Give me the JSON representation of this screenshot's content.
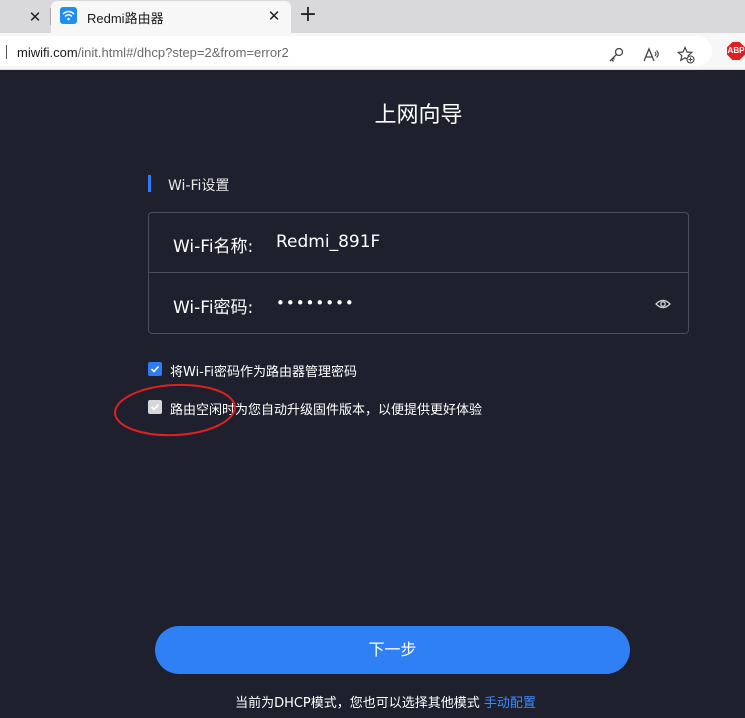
{
  "browser": {
    "tab_title": "Redmi路由器",
    "close_glyph": "✕",
    "new_tab_glyph": "+",
    "url_host": "miwifi.com",
    "url_path": "/init.html#/dhcp?step=2&from=error2",
    "icons": [
      "wifi-favicon-icon",
      "key-icon",
      "read-aloud-icon",
      "favorite-icon",
      "adblock-icon"
    ],
    "abp_label": "ABP"
  },
  "page": {
    "title": "上网向导",
    "section_label": "Wi-Fi设置",
    "wifi_name": {
      "label": "Wi-Fi名称:",
      "value": "Redmi_891F"
    },
    "wifi_password": {
      "label": "Wi-Fi密码:",
      "value": "••••••••"
    },
    "options": [
      {
        "label": "将Wi-Fi密码作为路由器管理密码",
        "checked": true
      },
      {
        "label": "路由空闲时为您自动升级固件版本，以便提供更好体验",
        "checked": false
      }
    ],
    "next_button": "下一步",
    "footer_text": "当前为DHCP模式，您也可以选择其他模式",
    "footer_link": "手动配置"
  },
  "colors": {
    "background": "#1e202d",
    "accent": "#2f7ff5",
    "link": "#3d8bff",
    "annotation": "#e02020"
  }
}
